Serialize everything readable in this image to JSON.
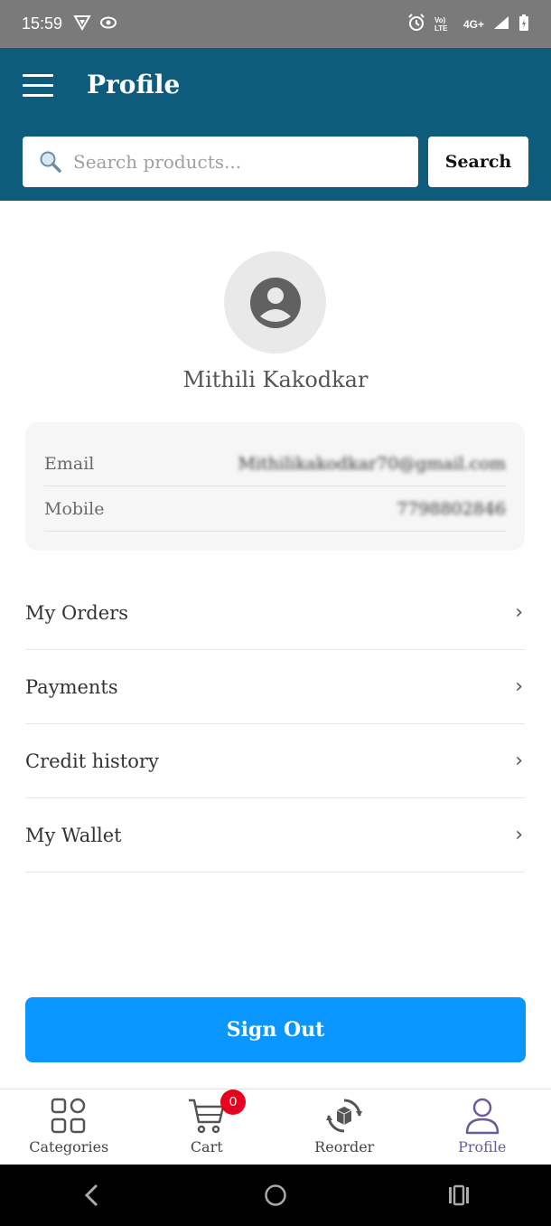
{
  "status_bar": {
    "time": "15:59",
    "network": "4G+",
    "volte": "Vo) LTE"
  },
  "header": {
    "title": "Profile",
    "search_placeholder": "Search products...",
    "search_button": "Search",
    "background_color": "#0d5c7c"
  },
  "profile": {
    "name": "Mithili Kakodkar",
    "fields": [
      {
        "label": "Email",
        "value": "Mithilikakodkar70@gmail.com"
      },
      {
        "label": "Mobile",
        "value": "7798802846"
      }
    ]
  },
  "menu": [
    {
      "label": "My Orders"
    },
    {
      "label": "Payments"
    },
    {
      "label": "Credit history"
    },
    {
      "label": "My Wallet"
    }
  ],
  "sign_out": {
    "label": "Sign Out",
    "color": "#0a96ff"
  },
  "bottom_nav": {
    "items": [
      {
        "label": "Categories",
        "icon": "grid-icon"
      },
      {
        "label": "Cart",
        "icon": "cart-icon"
      },
      {
        "label": "Reorder",
        "icon": "reorder-icon"
      },
      {
        "label": "Profile",
        "icon": "user-icon"
      }
    ],
    "cart_count": "0",
    "active_color": "#6b5b9a"
  }
}
